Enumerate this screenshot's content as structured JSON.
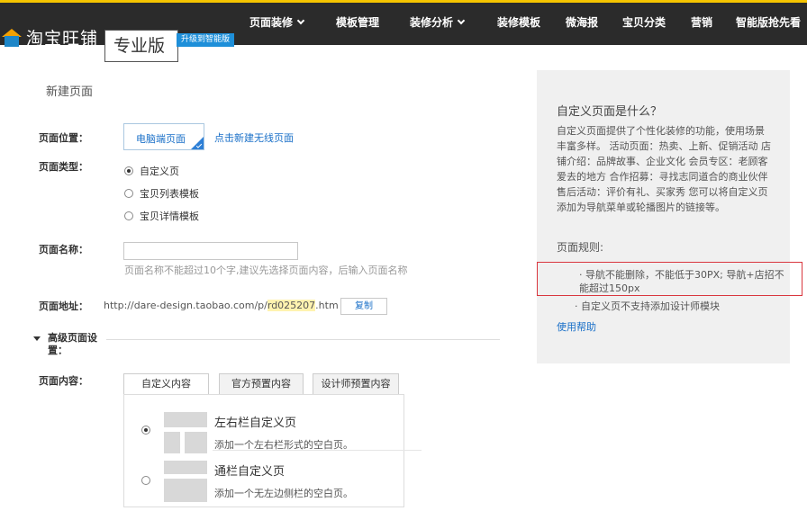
{
  "topbar": {
    "logo_text": "淘宝旺铺",
    "edition": "专业版",
    "upgrade_badge": "升级到智能版",
    "nav": [
      {
        "label": "页面装修",
        "dropdown": true
      },
      {
        "label": "模板管理",
        "dropdown": false
      },
      {
        "label": "装修分析",
        "dropdown": true
      },
      {
        "label": "装修模板",
        "dropdown": false
      },
      {
        "label": "微海报",
        "dropdown": false
      },
      {
        "label": "宝贝分类",
        "dropdown": false
      },
      {
        "label": "营销",
        "dropdown": false
      },
      {
        "label": "智能版抢先看",
        "dropdown": false
      }
    ],
    "accent_color": "#f5c400",
    "background_color": "#2b2b2b"
  },
  "form": {
    "page_title": "新建页面",
    "position_label": "页面位置：",
    "position_tab": "电脑端页面",
    "position_link": "点击新建无线页面",
    "type_label": "页面类型：",
    "types": [
      {
        "label": "自定义页",
        "checked": true
      },
      {
        "label": "宝贝列表模板",
        "checked": false
      },
      {
        "label": "宝贝详情模板",
        "checked": false
      }
    ],
    "name_label": "页面名称：",
    "name_value": "",
    "name_hint": "页面名称不能超过10个字,建议先选择页面内容，后输入页面名称",
    "url_label": "页面地址：",
    "url_prefix": "http://dare-design.taobao.com/p/",
    "url_code": "rd025207",
    "url_suffix": ".htm",
    "copy_button": "复制",
    "advanced_label": "高级页面设置：",
    "content_label": "页面内容：",
    "content_tabs": [
      "自定义内容",
      "官方预置内容",
      "设计师预置内容"
    ],
    "active_content_tab": "自定义内容",
    "layouts": [
      {
        "title": "左右栏自定义页",
        "desc": "添加一个左右栏形式的空白页。",
        "checked": true
      },
      {
        "title": "通栏自定义页",
        "desc": "添加一个无左边侧栏的空白页。",
        "checked": false
      }
    ]
  },
  "side": {
    "heading": "自定义页面是什么？",
    "body": "自定义页面提供了个性化装修的功能，使用场景丰富多样。 活动页面：热卖、上新、促销活动 店铺介绍：品牌故事、企业文化 会员专区：老顾客爱去的地方 合作招募：寻找志同道合的商业伙伴 售后活动：评价有礼、买家秀 您可以将自定义页添加为导航菜单或轮播图片的链接等。",
    "rules_heading": "页面规则:",
    "rule1": "· 导航不能删除，不能低于30PX; 导航+店招不能超过150px",
    "rule2": "· 自定义页不支持添加设计师模块",
    "help_link": "使用帮助",
    "highlight_color": "#d9363e",
    "link_color": "#1a70c8"
  }
}
